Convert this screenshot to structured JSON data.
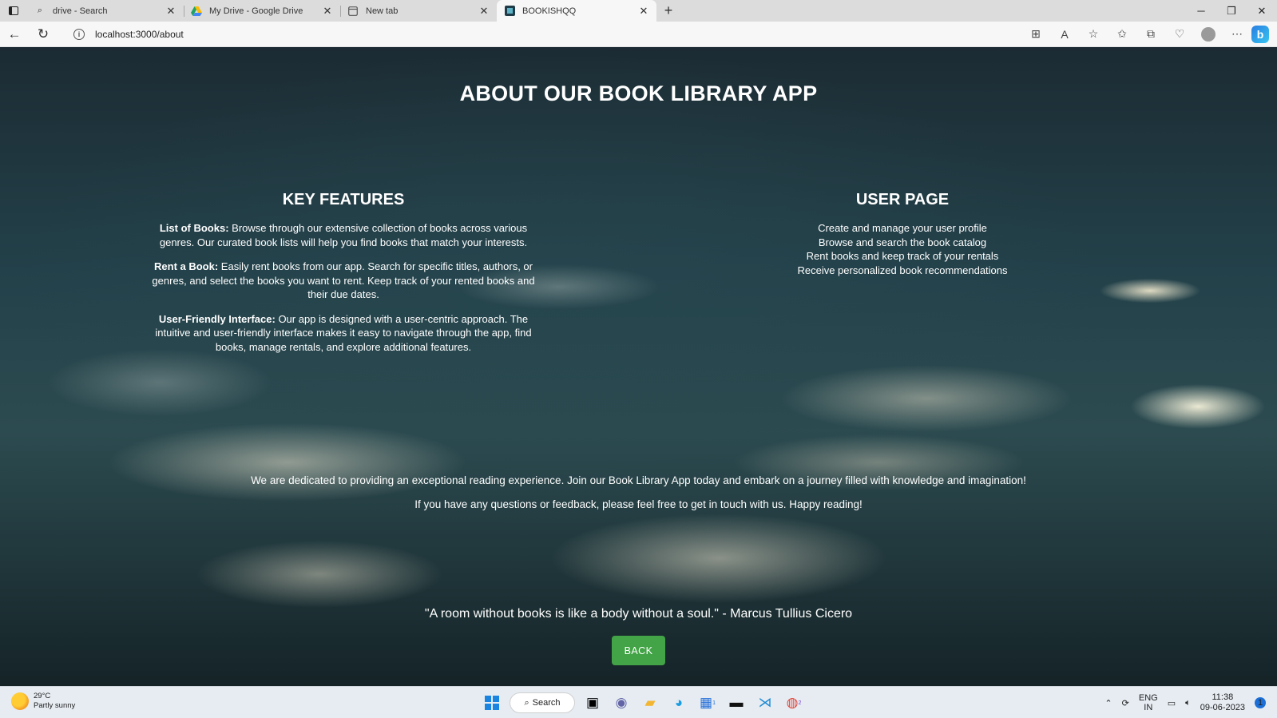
{
  "browser": {
    "tabs": [
      {
        "label": "drive - Search",
        "icon": "search-icon"
      },
      {
        "label": "My Drive - Google Drive",
        "icon": "google-drive-icon"
      },
      {
        "label": "New tab",
        "icon": "new-tab-page-icon"
      },
      {
        "label": "BOOKISHQQ",
        "icon": "site-favicon"
      }
    ],
    "url": "localhost:3000/about"
  },
  "page": {
    "title": "ABOUT OUR BOOK LIBRARY APP",
    "features": {
      "heading": "KEY FEATURES",
      "items": [
        {
          "title": "List of Books:",
          "text": " Browse through our extensive collection of books across various genres. Our curated book lists will help you find books that match your interests."
        },
        {
          "title": "Rent a Book:",
          "text": " Easily rent books from our app. Search for specific titles, authors, or genres, and select the books you want to rent. Keep track of your rented books and their due dates."
        },
        {
          "title": "User-Friendly Interface:",
          "text": " Our app is designed with a user-centric approach. The intuitive and user-friendly interface makes it easy to navigate through the app, find books, manage rentals, and explore additional features."
        }
      ]
    },
    "user_page": {
      "heading": "USER PAGE",
      "items": [
        "Create and manage your user profile",
        "Browse and search the book catalog",
        "Rent books and keep track of your rentals",
        "Receive personalized book recommendations"
      ]
    },
    "mission": "We are dedicated to providing an exceptional reading experience. Join our Book Library App today and embark on a journey filled with knowledge and imagination!",
    "contact": "If you have any questions or feedback, please feel free to get in touch with us. Happy reading!",
    "quote": "\"A room without books is like a body without a soul.\" - Marcus Tullius Cicero",
    "back_label": "BACK",
    "back_color": "#43a447"
  },
  "taskbar": {
    "weather_temp": "29°C",
    "weather_desc": "Partly sunny",
    "search_label": "Search",
    "lang_1": "ENG",
    "lang_2": "IN",
    "time": "11:38",
    "date": "09-06-2023",
    "notification_count": "1",
    "store_badge": "1",
    "chrome_badge": "2"
  }
}
